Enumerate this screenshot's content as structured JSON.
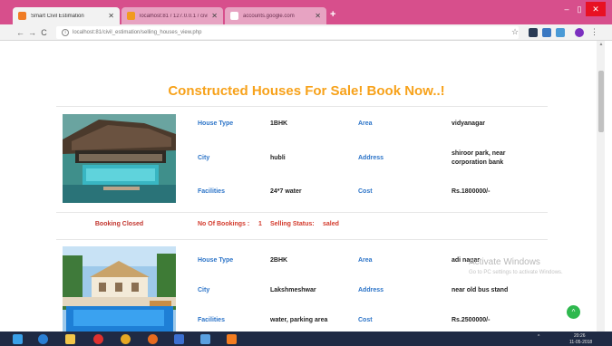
{
  "browser": {
    "tabs": [
      {
        "label": "Smart Civil Estimation",
        "active": true
      },
      {
        "label": "localhost:81 / 127.0.0.1 / civil_es",
        "active": false
      },
      {
        "label": "accounts.google.com",
        "active": false
      }
    ],
    "new_tab_symbol": "+",
    "address": "localhost:81/civil_estimation/selling_houses_view.php",
    "window_controls": {
      "minimize": "–",
      "maximize": "▯",
      "close": "✕"
    },
    "nav": {
      "back": "←",
      "forward": "→",
      "reload": "C"
    }
  },
  "page": {
    "title": "Constructed Houses For Sale! Book Now..!",
    "labels": {
      "house_type": "House Type",
      "area": "Area",
      "city": "City",
      "address": "Address",
      "facilities": "Facilities",
      "cost": "Cost",
      "no_of_bookings": "No Of Bookings :",
      "selling_status": "Selling Status:"
    },
    "listings": [
      {
        "house_type": "1BHK",
        "area": "vidyanagar",
        "city": "hubli",
        "address": "shiroor park, near corporation bank",
        "facilities": "24*7 water",
        "cost": "Rs.1800000/-",
        "status": "Booking Closed",
        "bookings": "1",
        "selling_status": "saled"
      },
      {
        "house_type": "2BHK",
        "area": "adi nagar",
        "city": "Lakshmeshwar",
        "address": "near old bus stand",
        "facilities": "water, parking area",
        "cost": "Rs.2500000/-"
      }
    ]
  },
  "overlay": {
    "watermark_title": "Activate Windows",
    "watermark_sub": "Go to PC settings to activate Windows.",
    "float_button": "^"
  },
  "taskbar": {
    "tray_arrow": "^",
    "time": "20:26",
    "date": "11-05-2018"
  },
  "colors": {
    "tabstrip": "#d74f8c",
    "title_orange": "#f7a21b",
    "label_blue": "#2c74c8",
    "status_red": "#d33a2c",
    "taskbar": "#1f2a44"
  },
  "icons": [
    "back-icon",
    "forward-icon",
    "reload-icon",
    "info-icon",
    "star-icon",
    "windows-start-icon",
    "edge-icon",
    "file-explorer-icon",
    "opera-icon",
    "chrome-icon",
    "firefox-icon",
    "media-player-icon",
    "notepad-icon",
    "xampp-icon"
  ]
}
